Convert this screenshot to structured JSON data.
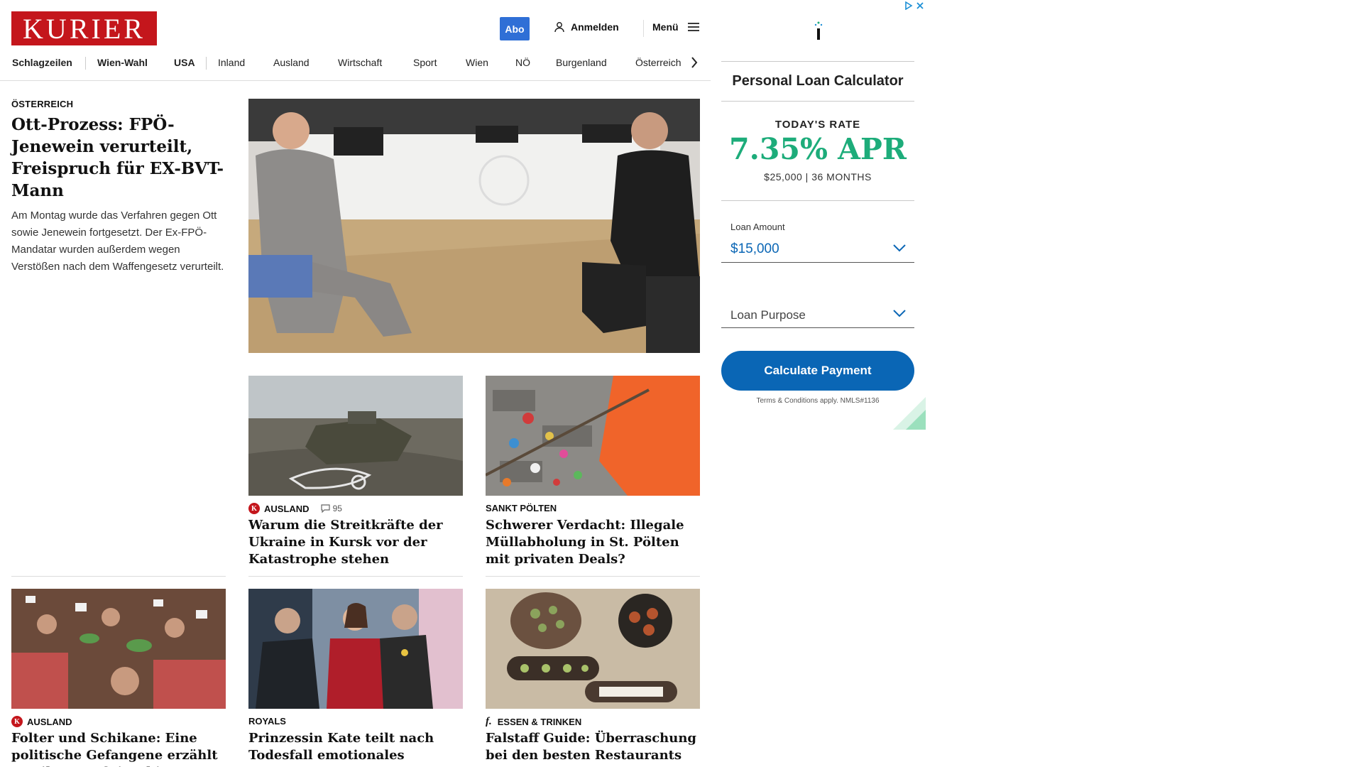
{
  "header": {
    "logo_text": "KURIER",
    "abo_label": "Abo",
    "login_label": "Anmelden",
    "menu_label": "Menü"
  },
  "nav": {
    "items": [
      "Schlagzeilen",
      "Wien-Wahl",
      "USA",
      "Inland",
      "Ausland",
      "Wirtschaft",
      "Sport",
      "Wien",
      "NÖ",
      "Burgenland",
      "Österreich"
    ]
  },
  "lead": {
    "kicker": "ÖSTERREICH",
    "title": "Ott-Prozess: FPÖ-Jenewein verurteilt, Freispruch für EX-BVT-Mann",
    "teaser": "Am Montag wurde das Verfahren gegen Ott sowie Jenewein fortgesetzt. Der Ex-FPÖ-Mandatar wurden außerdem wegen Verstößen nach dem Waffengesetz verurteilt."
  },
  "cards": [
    {
      "kicker": "AUSLAND",
      "badge": "K",
      "comments": "95",
      "title": "Warum die Streitkräfte der Ukraine in Kursk vor der Katastrophe stehen"
    },
    {
      "kicker": "SANKT PÖLTEN",
      "title": "Schwerer Verdacht: Illegale Müllabholung in St. Pölten mit privaten Deals?"
    },
    {
      "kicker": "AUSLAND",
      "badge": "K",
      "title": "Folter und Schikane: Eine politische Gefangene erzählt von ihrer Haft in China"
    },
    {
      "kicker": "ROYALS",
      "title": "Prinzessin Kate teilt nach Todesfall emotionales Statement"
    },
    {
      "kicker": "ESSEN & TRINKEN",
      "badge_text": "f.",
      "title": "Falstaff Guide: Überraschung bei den besten Restaurants"
    }
  ],
  "ad": {
    "title": "Personal Loan Calculator",
    "rate_label": "TODAY'S RATE",
    "rate_value": "7.35% APR",
    "rate_sub": "$25,000 | 36 MONTHS",
    "amount_label": "Loan Amount",
    "amount_value": "$15,000",
    "purpose_placeholder": "Loan Purpose",
    "button_label": "Calculate Payment",
    "terms": "Terms & Conditions apply. NMLS#1136",
    "colors": {
      "rate": "#1dac7a",
      "button": "#0a66b5"
    }
  },
  "colors": {
    "brand": "#c4161c",
    "abo": "#2f6fd6"
  }
}
